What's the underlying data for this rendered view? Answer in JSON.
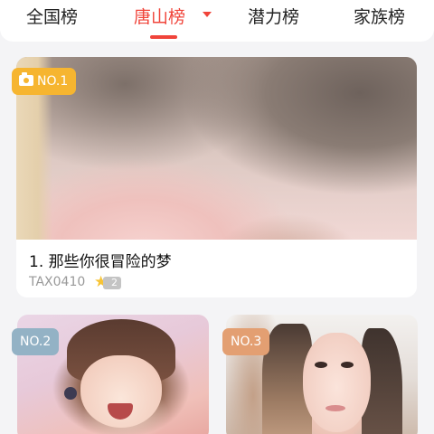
{
  "tabs": [
    {
      "label": "全国榜"
    },
    {
      "label": "唐山榜",
      "active": true
    },
    {
      "label": "潜力榜"
    },
    {
      "label": "家族榜"
    }
  ],
  "ranking": [
    {
      "badge": "NO.1",
      "title": "1. 那些你很冒险的梦",
      "author": "TAX0410",
      "level": "2"
    },
    {
      "badge": "NO.2"
    },
    {
      "badge": "NO.3"
    }
  ],
  "colors": {
    "accent": "#f0443a",
    "badge_gold": "#f6b530",
    "badge_silver": "#93b2c5",
    "badge_bronze": "#e39f72"
  },
  "icons": {
    "dropdown": "chevron-down-icon",
    "camera": "camera-icon",
    "level": "star-icon"
  }
}
